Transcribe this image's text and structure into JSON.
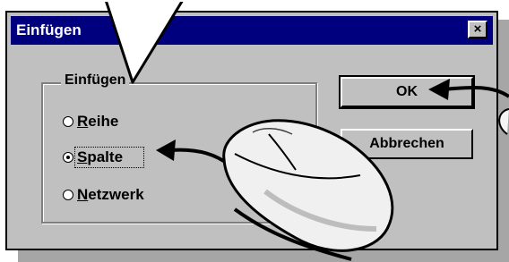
{
  "window": {
    "title": "Einfügen",
    "close_label": "×"
  },
  "group": {
    "label": "Einfügen",
    "options": [
      {
        "prefix": "",
        "accel": "R",
        "rest": "eihe",
        "checked": false
      },
      {
        "prefix": "",
        "accel": "S",
        "rest": "palte",
        "checked": true
      },
      {
        "prefix": "",
        "accel": "N",
        "rest": "etzwerk",
        "checked": false
      }
    ]
  },
  "buttons": {
    "ok_label": "OK",
    "cancel_label": "Abbrechen"
  },
  "colors": {
    "titlebar": "#00007f",
    "dialog_face": "#c0c0c0",
    "mouse_body": "#f0f0f0"
  },
  "icons": [
    "close-icon",
    "callout-pointer-icon",
    "mouse-icon",
    "arrow-to-ok-icon",
    "arrow-to-spalte-icon"
  ]
}
